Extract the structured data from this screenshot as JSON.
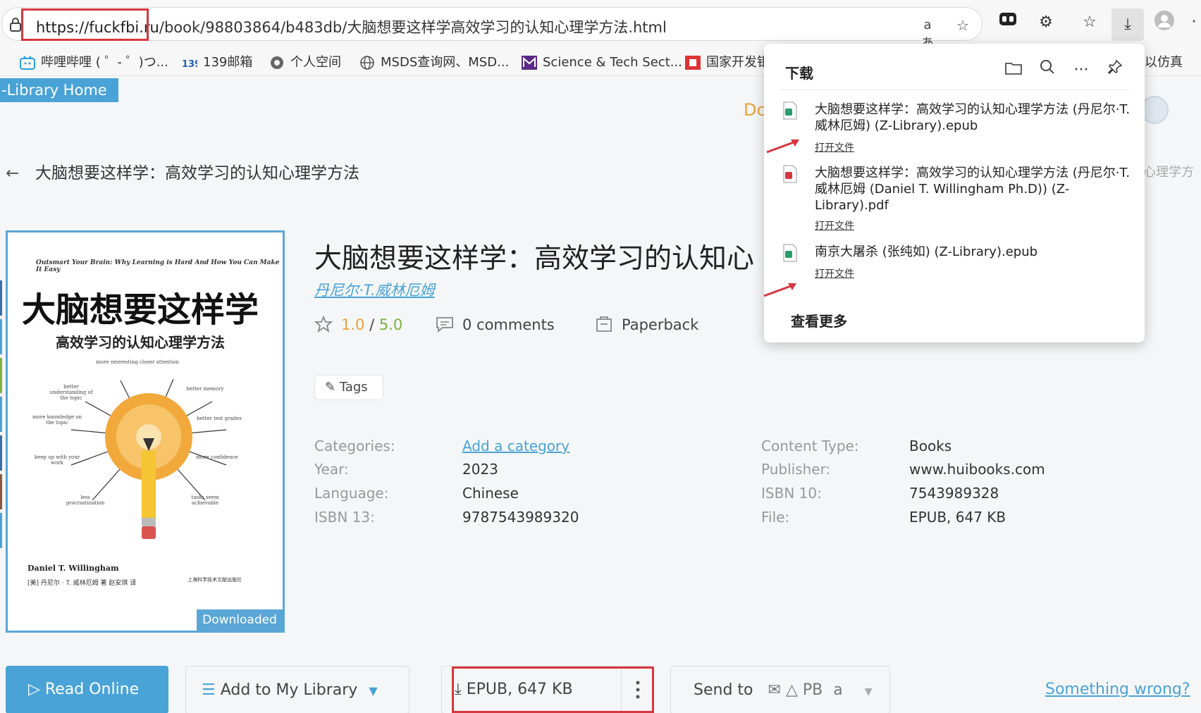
{
  "browser": {
    "url_highlight": "https://fuckfbi.ru",
    "url_rest": "/book/98803864/b483db/大脑想要这样学高效学习的认知心理学方法.html",
    "read_aloud_glyph": "aあ"
  },
  "bookmarks": [
    {
      "label": "哔哩哔哩 ( ゜- ゜)つ...",
      "icon": "bilibili-icon"
    },
    {
      "label": "139邮箱",
      "icon": "mail139-icon"
    },
    {
      "label": "个人空间",
      "icon": "space-icon"
    },
    {
      "label": "MSDS查询网、MSD...",
      "icon": "globe-icon"
    },
    {
      "label": "Science & Tech Sect...",
      "icon": "m-logo-icon"
    },
    {
      "label": "国家开发银",
      "icon": "bank-icon"
    },
    {
      "label": "以仿真",
      "icon": "none"
    }
  ],
  "page": {
    "library_home": "-Library Home",
    "partial_d": "Dc",
    "right_fragment": "心理学方",
    "breadcrumb": "大脑想要这样学：高效学习的认知心理学方法",
    "title": "大脑想要这样学：高效学习的认知心",
    "author": "丹尼尔·T.威林厄姆",
    "rating_value": "1.0",
    "rating_sep": " / ",
    "rating_max": "5.0",
    "comments": "0 comments",
    "format_badge": "Paperback",
    "tags": "Tags",
    "cover": {
      "subtitle_en": "Outsmart Your Brain: Why Learning is Hard And How You Can Make It Easy",
      "title_big": "大脑想要这样学",
      "subtitle_cn": "高效学习的认知心理学方法",
      "author_en": "Daniel T. Willingham",
      "author_cn": "[美] 丹尼尔 · T. 威林厄姆  著    赵安琪  译",
      "publisher": "上海科学技术文献出版社",
      "downloaded": "Downloaded",
      "labels": {
        "more_interesting": "more interesting",
        "closer_attention": "closer attention",
        "better_understanding": "better understanding of the topic",
        "better_memory": "better memory",
        "more_knowledge": "more knowledge on the topic",
        "better_test_grades": "better test grades",
        "keep_up": "keep up with your work",
        "more_confidence": "more confidence",
        "less_procrastination": "less procrastination",
        "tasks_achievable": "tasks seem achievable"
      }
    },
    "details_left": [
      {
        "label": "Categories:",
        "value": "Add a category",
        "link": true
      },
      {
        "label": "Year:",
        "value": "2023"
      },
      {
        "label": "Language:",
        "value": "Chinese"
      },
      {
        "label": "ISBN 13:",
        "value": "9787543989320"
      }
    ],
    "details_right": [
      {
        "label": "Content Type:",
        "value": "Books"
      },
      {
        "label": "Publisher:",
        "value": "www.huibooks.com"
      },
      {
        "label": "ISBN 10:",
        "value": "7543989328"
      },
      {
        "label": "File:",
        "value": "EPUB, 647 KB"
      }
    ],
    "buttons": {
      "read_online": "Read Online",
      "add_library": "Add to My Library",
      "download": "EPUB, 647 KB",
      "send_to": "Send to",
      "send_pb": "PB",
      "send_amazon": "a",
      "something_wrong": "Something wrong?"
    }
  },
  "downloads_panel": {
    "title": "下载",
    "items": [
      {
        "name": "大脑想要这样学：高效学习的认知心理学方法 (丹尼尔·T.威林厄姆) (Z-Library).epub",
        "action": "打开文件",
        "type": "epub"
      },
      {
        "name": "大脑想要这样学：高效学习的认知心理学方法 (丹尼尔·T.威林厄姆 (Daniel T. Willingham Ph.D)) (Z-Library).pdf",
        "action": "打开文件",
        "type": "pdf"
      },
      {
        "name": "南京大屠杀 (张纯如) (Z-Library).epub",
        "action": "打开文件",
        "type": "epub"
      }
    ],
    "see_more": "查看更多"
  },
  "colors": {
    "accent": "#49a3d6",
    "highlight_box": "#d6363f",
    "rating_orange": "#e8a23a",
    "rating_green": "#7bb33f"
  }
}
